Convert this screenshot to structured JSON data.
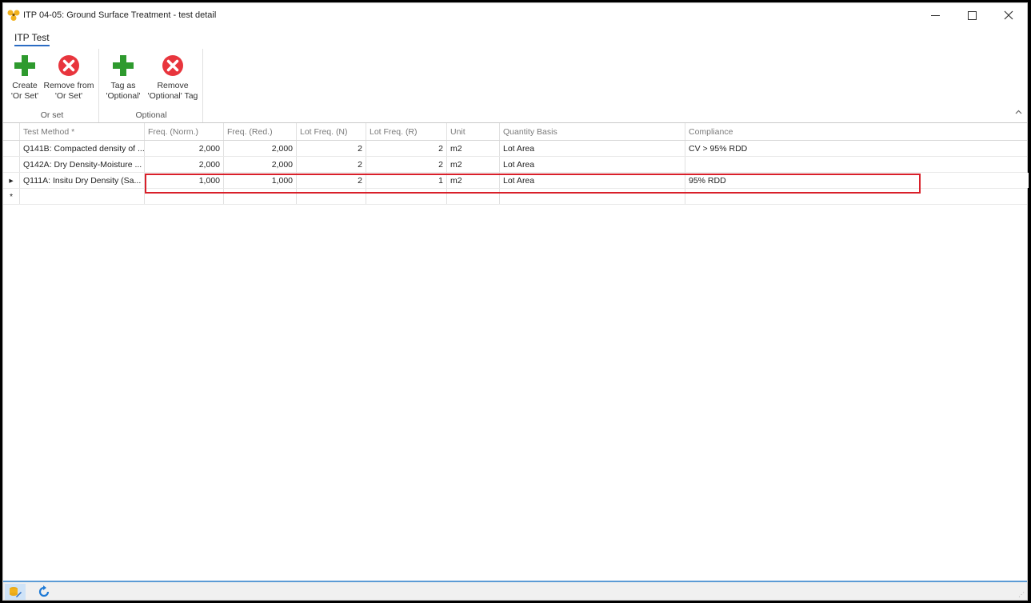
{
  "window": {
    "title": "ITP 04-05: Ground Surface Treatment - test detail",
    "app_icon": "radiation-icon"
  },
  "ribbon": {
    "tab_label": "ITP Test",
    "groups": [
      {
        "label": "Or set",
        "buttons": [
          {
            "line1": "Create",
            "line2": "'Or Set'",
            "icon": "plus-icon",
            "color": "#2e9a2e"
          },
          {
            "line1": "Remove from",
            "line2": "'Or Set'",
            "icon": "remove-icon",
            "color": "#e8353d"
          }
        ]
      },
      {
        "label": "Optional",
        "buttons": [
          {
            "line1": "Tag as",
            "line2": "'Optional'",
            "icon": "plus-icon",
            "color": "#2e9a2e"
          },
          {
            "line1": "Remove",
            "line2": "'Optional' Tag",
            "icon": "remove-icon",
            "color": "#e8353d"
          }
        ]
      }
    ]
  },
  "grid": {
    "headers": {
      "test_method": "Test Method *",
      "freq_norm": "Freq. (Norm.)",
      "freq_red": "Freq. (Red.)",
      "lot_freq_n": "Lot Freq. (N)",
      "lot_freq_r": "Lot Freq. (R)",
      "unit": "Unit",
      "quantity_basis": "Quantity Basis",
      "compliance": "Compliance"
    },
    "rows": [
      {
        "test_method": "Q141B: Compacted density of ...",
        "freq_norm": "2,000",
        "freq_red": "2,000",
        "lot_freq_n": "2",
        "lot_freq_r": "2",
        "unit": "m2",
        "quantity_basis": "Lot Area",
        "compliance": "CV > 95% RDD"
      },
      {
        "test_method": "Q142A: Dry Density-Moisture ...",
        "freq_norm": "2,000",
        "freq_red": "2,000",
        "lot_freq_n": "2",
        "lot_freq_r": "2",
        "unit": "m2",
        "quantity_basis": "Lot Area",
        "compliance": ""
      },
      {
        "test_method": "Q111A: Insitu Dry Density (Sa...",
        "freq_norm": "1,000",
        "freq_red": "1,000",
        "lot_freq_n": "2",
        "lot_freq_r": "1",
        "unit": "m2",
        "quantity_basis": "Lot Area",
        "compliance": "95% RDD"
      }
    ],
    "new_row_marker": "*",
    "current_row_marker": "▸",
    "highlight_color": "#d9202a"
  },
  "statusbar": {
    "buttons": [
      "edit-icon",
      "refresh-icon"
    ]
  }
}
